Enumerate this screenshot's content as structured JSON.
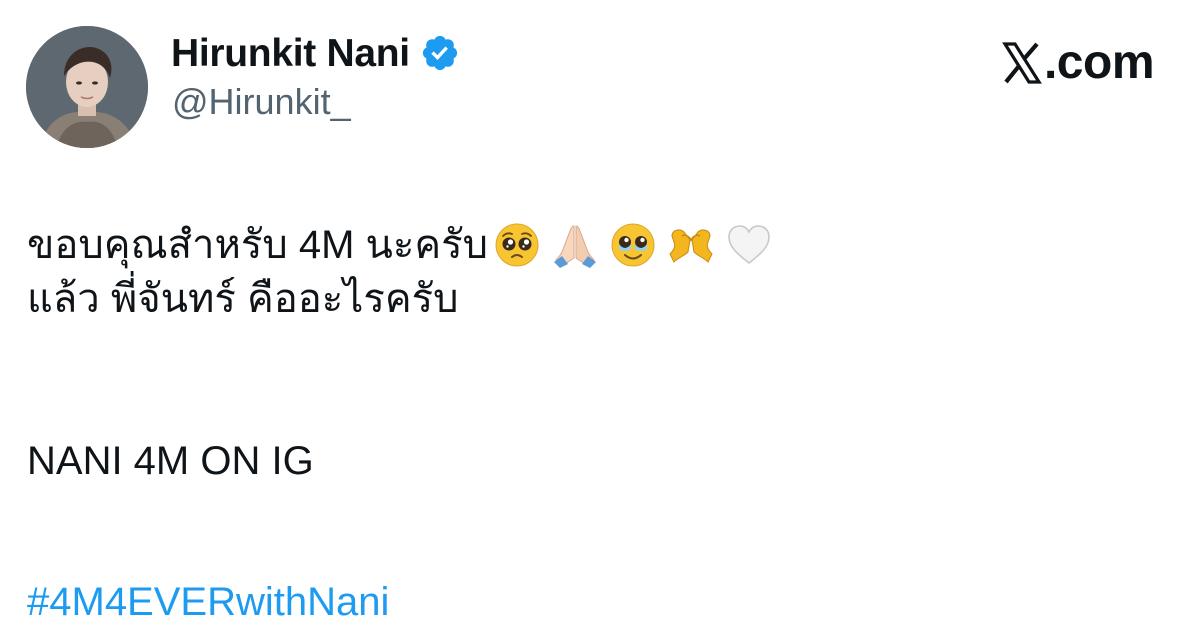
{
  "author": {
    "display_name": "Hirunkit Nani",
    "handle": "@Hirunkit_",
    "verified": true,
    "avatar_icon": "profile-photo"
  },
  "brand": {
    "logo_icon": "x-logo-icon",
    "text": ".com"
  },
  "tweet": {
    "line1": "ขอบคุณสำหรับ 4M นะครับ",
    "line1_emojis": [
      "pleading-face",
      "folded-hands",
      "face-holding-back-tears",
      "heart-hands",
      "white-heart"
    ],
    "line2": "แล้ว พี่จันทร์ คืออะไรครับ",
    "line3": "NANI 4M ON IG",
    "hashtag": "#4M4EVERwithNani"
  },
  "colors": {
    "link": "#1d9bf0",
    "verified": "#1d9bf0",
    "text": "#0f1419",
    "secondary": "#536471"
  }
}
